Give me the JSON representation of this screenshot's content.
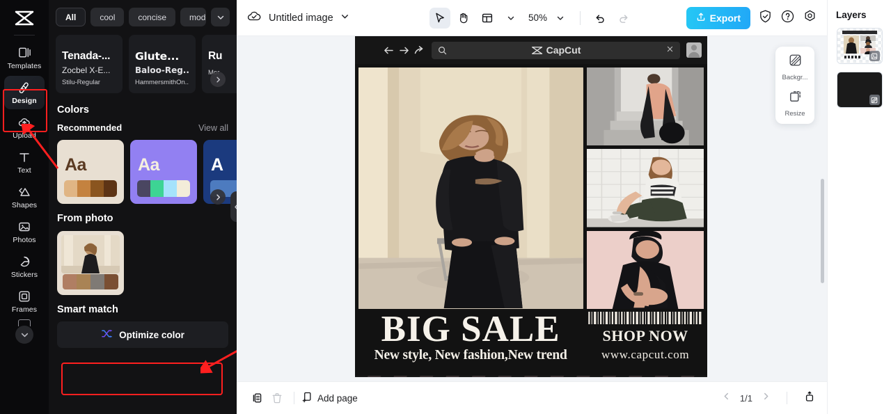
{
  "app": {
    "name": "CapCut",
    "brand_color": "#21a8f7"
  },
  "rail": {
    "logo": "capcut-logo",
    "items": [
      {
        "label": "Templates",
        "icon": "templates-icon",
        "active": false
      },
      {
        "label": "Design",
        "icon": "design-icon",
        "active": true
      },
      {
        "label": "Upload",
        "icon": "upload-cloud-icon",
        "active": false
      },
      {
        "label": "Text",
        "icon": "text-icon",
        "active": false
      },
      {
        "label": "Shapes",
        "icon": "shapes-icon",
        "active": false
      },
      {
        "label": "Photos",
        "icon": "photos-icon",
        "active": false
      },
      {
        "label": "Stickers",
        "icon": "stickers-icon",
        "active": false
      },
      {
        "label": "Frames",
        "icon": "frames-icon",
        "active": false
      }
    ],
    "more_icon": "chevron-down-icon"
  },
  "design_panel": {
    "filter_chips": [
      {
        "label": "All",
        "active": true
      },
      {
        "label": "cool",
        "active": false
      },
      {
        "label": "concise",
        "active": false
      },
      {
        "label": "modern",
        "active": false
      }
    ],
    "chips_dropdown_icon": "chevron-down-icon",
    "font_cards": [
      {
        "line1": "Tenada-...",
        "line2": "Zocbel X-E...",
        "line3": "Stilu-Regular"
      },
      {
        "line1": "Glute...",
        "line2": "Baloo-Reg...",
        "line3": "HammersmithOn..."
      },
      {
        "line1": "Ru",
        "line2": "",
        "line3": "Mor"
      }
    ],
    "fonts_next_icon": "chevron-right-icon",
    "colors_heading": "Colors",
    "recommended_label": "Recommended",
    "view_all_label": "View all",
    "palettes": [
      {
        "sample_text": "Aa",
        "bg": "#e8dfd2",
        "text_color": "#5a3a22",
        "swatches": [
          "#e0b584",
          "#c4823f",
          "#8a551f",
          "#5d3415"
        ]
      },
      {
        "sample_text": "Aa",
        "bg": "#9280f2",
        "text_color": "#f5efe0",
        "swatches": [
          "#4a4661",
          "#3dd494",
          "#a5e2fb",
          "#f3ecd9"
        ]
      },
      {
        "sample_text": "A",
        "bg": "#1b3a7e",
        "text_color": "#ffffff",
        "swatches": [
          "#4d7bbf"
        ]
      }
    ],
    "palettes_next_icon": "chevron-right-icon",
    "from_photo_label": "From photo",
    "from_photo_swatches": [
      "#b07e63",
      "#a98355",
      "#7f7a75",
      "#7a4f33"
    ],
    "smart_match_label": "Smart match",
    "optimize_button": {
      "label": "Optimize color",
      "icon": "shuffle-icon"
    },
    "collapse_handle_icon": "chevron-left-icon"
  },
  "topbar": {
    "cloud_icon": "cloud-saved-icon",
    "doc_title": "Untitled image",
    "title_dropdown_icon": "chevron-down-icon",
    "tools": [
      {
        "name": "select-tool",
        "icon": "cursor-arrow-icon",
        "selected": true
      },
      {
        "name": "hand-tool",
        "icon": "hand-icon",
        "selected": false
      },
      {
        "name": "layout-tool",
        "icon": "layout-icon",
        "selected": false
      }
    ],
    "layout_dropdown_icon": "chevron-down-icon",
    "zoom_level": "50%",
    "zoom_dropdown_icon": "chevron-down-icon",
    "undo_icon": "undo-icon",
    "redo_icon": "redo-icon",
    "export_label": "Export",
    "export_icon": "export-upload-icon",
    "shield_icon": "shield-check-icon",
    "help_icon": "question-circle-icon",
    "settings_icon": "gear-icon"
  },
  "canvas": {
    "browser_mock": {
      "back_icon": "arrow-left-icon",
      "forward_icon": "arrow-right-icon",
      "reload_icon": "share-arrow-icon",
      "search_icon": "magnifier-icon",
      "brand_text": "CapCut",
      "brand_logo": "capcut-logo",
      "close_icon": "close-x-icon",
      "avatar_icon": "user-avatar-icon"
    },
    "poster": {
      "headline": "BIG SALE",
      "subheadline": "New style, New fashion,New trend",
      "cta": "SHOP NOW",
      "url": "www.capcut.com",
      "background": "#121212"
    }
  },
  "float_tools": [
    {
      "label": "Backgr...",
      "icon": "background-icon"
    },
    {
      "label": "Resize",
      "icon": "resize-icon"
    }
  ],
  "bottombar": {
    "duplicate_icon": "duplicate-page-icon",
    "delete_icon": "trash-icon",
    "add_page_label": "Add page",
    "add_page_icon": "add-page-icon",
    "prev_icon": "chevron-left-icon",
    "page_indicator": "1/1",
    "next_icon": "chevron-right-icon",
    "expand_icon": "expand-panel-icon"
  },
  "layers": {
    "title": "Layers",
    "items": [
      {
        "name": "layer-design-thumbnail",
        "badge": "image-badge-icon"
      },
      {
        "name": "layer-background",
        "badge": "background-badge-icon",
        "color": "#1b1b1b"
      }
    ]
  },
  "annotations": {
    "highlight_color": "#ff1f1f",
    "arrows": [
      {
        "target": "sidebar-item-design"
      },
      {
        "target": "optimize-color-button"
      }
    ]
  }
}
